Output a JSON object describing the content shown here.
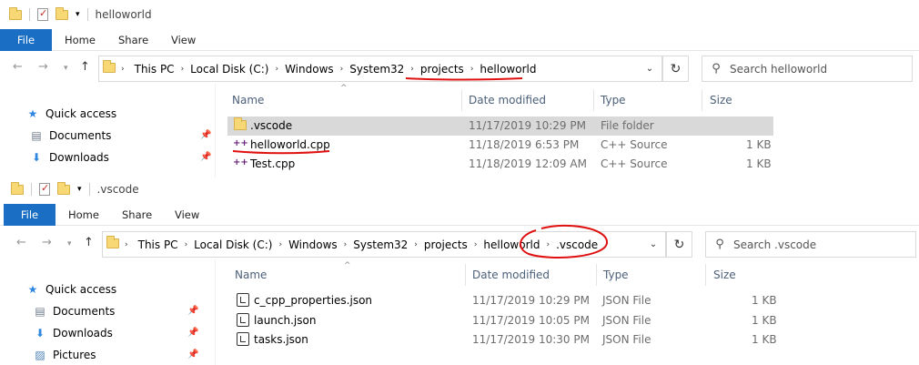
{
  "colors": {
    "file_tab": "#1a6fc4",
    "selection": "#d9d9d9",
    "annotation": "#e01010"
  },
  "window_a": {
    "title": "helloworld",
    "ribbon": {
      "file": "File",
      "home": "Home",
      "share": "Share",
      "view": "View"
    },
    "breadcrumbs": [
      "This PC",
      "Local Disk (C:)",
      "Windows",
      "System32",
      "projects",
      "helloworld"
    ],
    "search_placeholder": "Search helloworld",
    "nav": {
      "quick_access": "Quick access",
      "documents": "Documents",
      "downloads": "Downloads"
    },
    "columns": {
      "name": "Name",
      "date": "Date modified",
      "type": "Type",
      "size": "Size"
    },
    "files": [
      {
        "name": ".vscode",
        "date": "11/17/2019 10:29 PM",
        "type": "File folder",
        "size": "",
        "icon": "folder-icon"
      },
      {
        "name": "helloworld.cpp",
        "date": "11/18/2019 6:53 PM",
        "type": "C++ Source",
        "size": "1 KB",
        "icon": "cpp-file-icon"
      },
      {
        "name": "Test.cpp",
        "date": "11/18/2019 12:09 AM",
        "type": "C++ Source",
        "size": "1 KB",
        "icon": "cpp-file-icon"
      }
    ]
  },
  "window_b": {
    "title": ".vscode",
    "ribbon": {
      "file": "File",
      "home": "Home",
      "share": "Share",
      "view": "View"
    },
    "breadcrumbs": [
      "This PC",
      "Local Disk (C:)",
      "Windows",
      "System32",
      "projects",
      "helloworld",
      ".vscode"
    ],
    "search_placeholder": "Search .vscode",
    "nav": {
      "quick_access": "Quick access",
      "documents": "Documents",
      "downloads": "Downloads",
      "pictures": "Pictures"
    },
    "columns": {
      "name": "Name",
      "date": "Date modified",
      "type": "Type",
      "size": "Size"
    },
    "files": [
      {
        "name": "c_cpp_properties.json",
        "date": "11/17/2019 10:29 PM",
        "type": "JSON File",
        "size": "1 KB",
        "icon": "json-file-icon"
      },
      {
        "name": "launch.json",
        "date": "11/17/2019 10:05 PM",
        "type": "JSON File",
        "size": "1 KB",
        "icon": "json-file-icon"
      },
      {
        "name": "tasks.json",
        "date": "11/17/2019 10:30 PM",
        "type": "JSON File",
        "size": "1 KB",
        "icon": "json-file-icon"
      }
    ]
  }
}
